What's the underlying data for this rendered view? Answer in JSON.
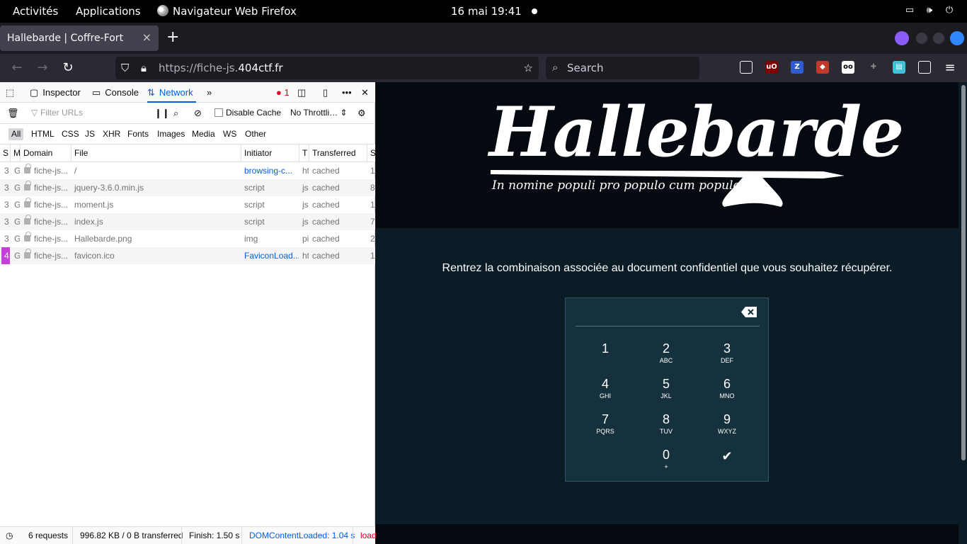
{
  "topbar": {
    "activities": "Activités",
    "applications": "Applications",
    "app_name": "Navigateur Web Firefox",
    "clock": "16 mai  19:41"
  },
  "tabbar": {
    "active_tab_title": "Hallebarde | Coffre-Fort",
    "close_glyph": "×",
    "new_tab_glyph": "+"
  },
  "navbar": {
    "url_prefix": "https://fiche-js.",
    "url_domain": "404ctf.fr",
    "search_placeholder": "Search"
  },
  "devtools": {
    "tabs": [
      "Inspector",
      "Console",
      "Network"
    ],
    "error_count": "1",
    "filter_placeholder": "Filter URLs",
    "disable_cache_label": "Disable Cache",
    "throttling_label": "No Throttli…",
    "type_filters": [
      "All",
      "HTML",
      "CSS",
      "JS",
      "XHR",
      "Fonts",
      "Images",
      "Media",
      "WS",
      "Other"
    ],
    "columns": [
      "S",
      "M",
      "Domain",
      "File",
      "Initiator",
      "T",
      "Transferred",
      "S"
    ],
    "rows": [
      {
        "status": "3",
        "method": "G",
        "domain": "fiche-js...",
        "file": "/",
        "initiator": "browsing-c...",
        "type": "ht",
        "transferred": "cached",
        "size": "1"
      },
      {
        "status": "3",
        "method": "G",
        "domain": "fiche-js...",
        "file": "jquery-3.6.0.min.js",
        "initiator": "script",
        "type": "js",
        "transferred": "cached",
        "size": "8"
      },
      {
        "status": "3",
        "method": "G",
        "domain": "fiche-js...",
        "file": "moment.js",
        "initiator": "script",
        "type": "js",
        "transferred": "cached",
        "size": "1"
      },
      {
        "status": "3",
        "method": "G",
        "domain": "fiche-js...",
        "file": "index.js",
        "initiator": "script",
        "type": "js",
        "transferred": "cached",
        "size": "7"
      },
      {
        "status": "3",
        "method": "G",
        "domain": "fiche-js...",
        "file": "Hallebarde.png",
        "initiator": "img",
        "type": "pi",
        "transferred": "cached",
        "size": "2"
      },
      {
        "status": "4",
        "method": "G",
        "domain": "fiche-js...",
        "file": "favicon.ico",
        "initiator": "FaviconLoad...",
        "type": "ht",
        "transferred": "cached",
        "size": "1"
      }
    ],
    "status_bar": {
      "requests": "6 requests",
      "size": "996.82 KB / 0 B transferred",
      "finish": "Finish: 1.50 s",
      "dom_loaded": "DOMContentLoaded: 1.04 s",
      "load": "load"
    }
  },
  "page": {
    "logo_title": "Hallebarde",
    "logo_motto": "In nomine populi pro populo cum populo",
    "prompt": "Rentrez la combinaison associée au document confidentiel que vous souhaitez récupérer.",
    "keys": [
      {
        "num": "1",
        "sub": ""
      },
      {
        "num": "2",
        "sub": "ABC"
      },
      {
        "num": "3",
        "sub": "DEF"
      },
      {
        "num": "4",
        "sub": "GHI"
      },
      {
        "num": "5",
        "sub": "JKL"
      },
      {
        "num": "6",
        "sub": "MNO"
      },
      {
        "num": "7",
        "sub": "PQRS"
      },
      {
        "num": "8",
        "sub": "TUV"
      },
      {
        "num": "9",
        "sub": "WXYZ"
      },
      {
        "num": "0",
        "sub": "+"
      }
    ],
    "check_glyph": "✔"
  },
  "colors": {
    "page_bg": "#0b1c27",
    "banner_bg": "#050a10",
    "keypad_bg": "#16313e",
    "devtools_accent": "#0060df"
  }
}
